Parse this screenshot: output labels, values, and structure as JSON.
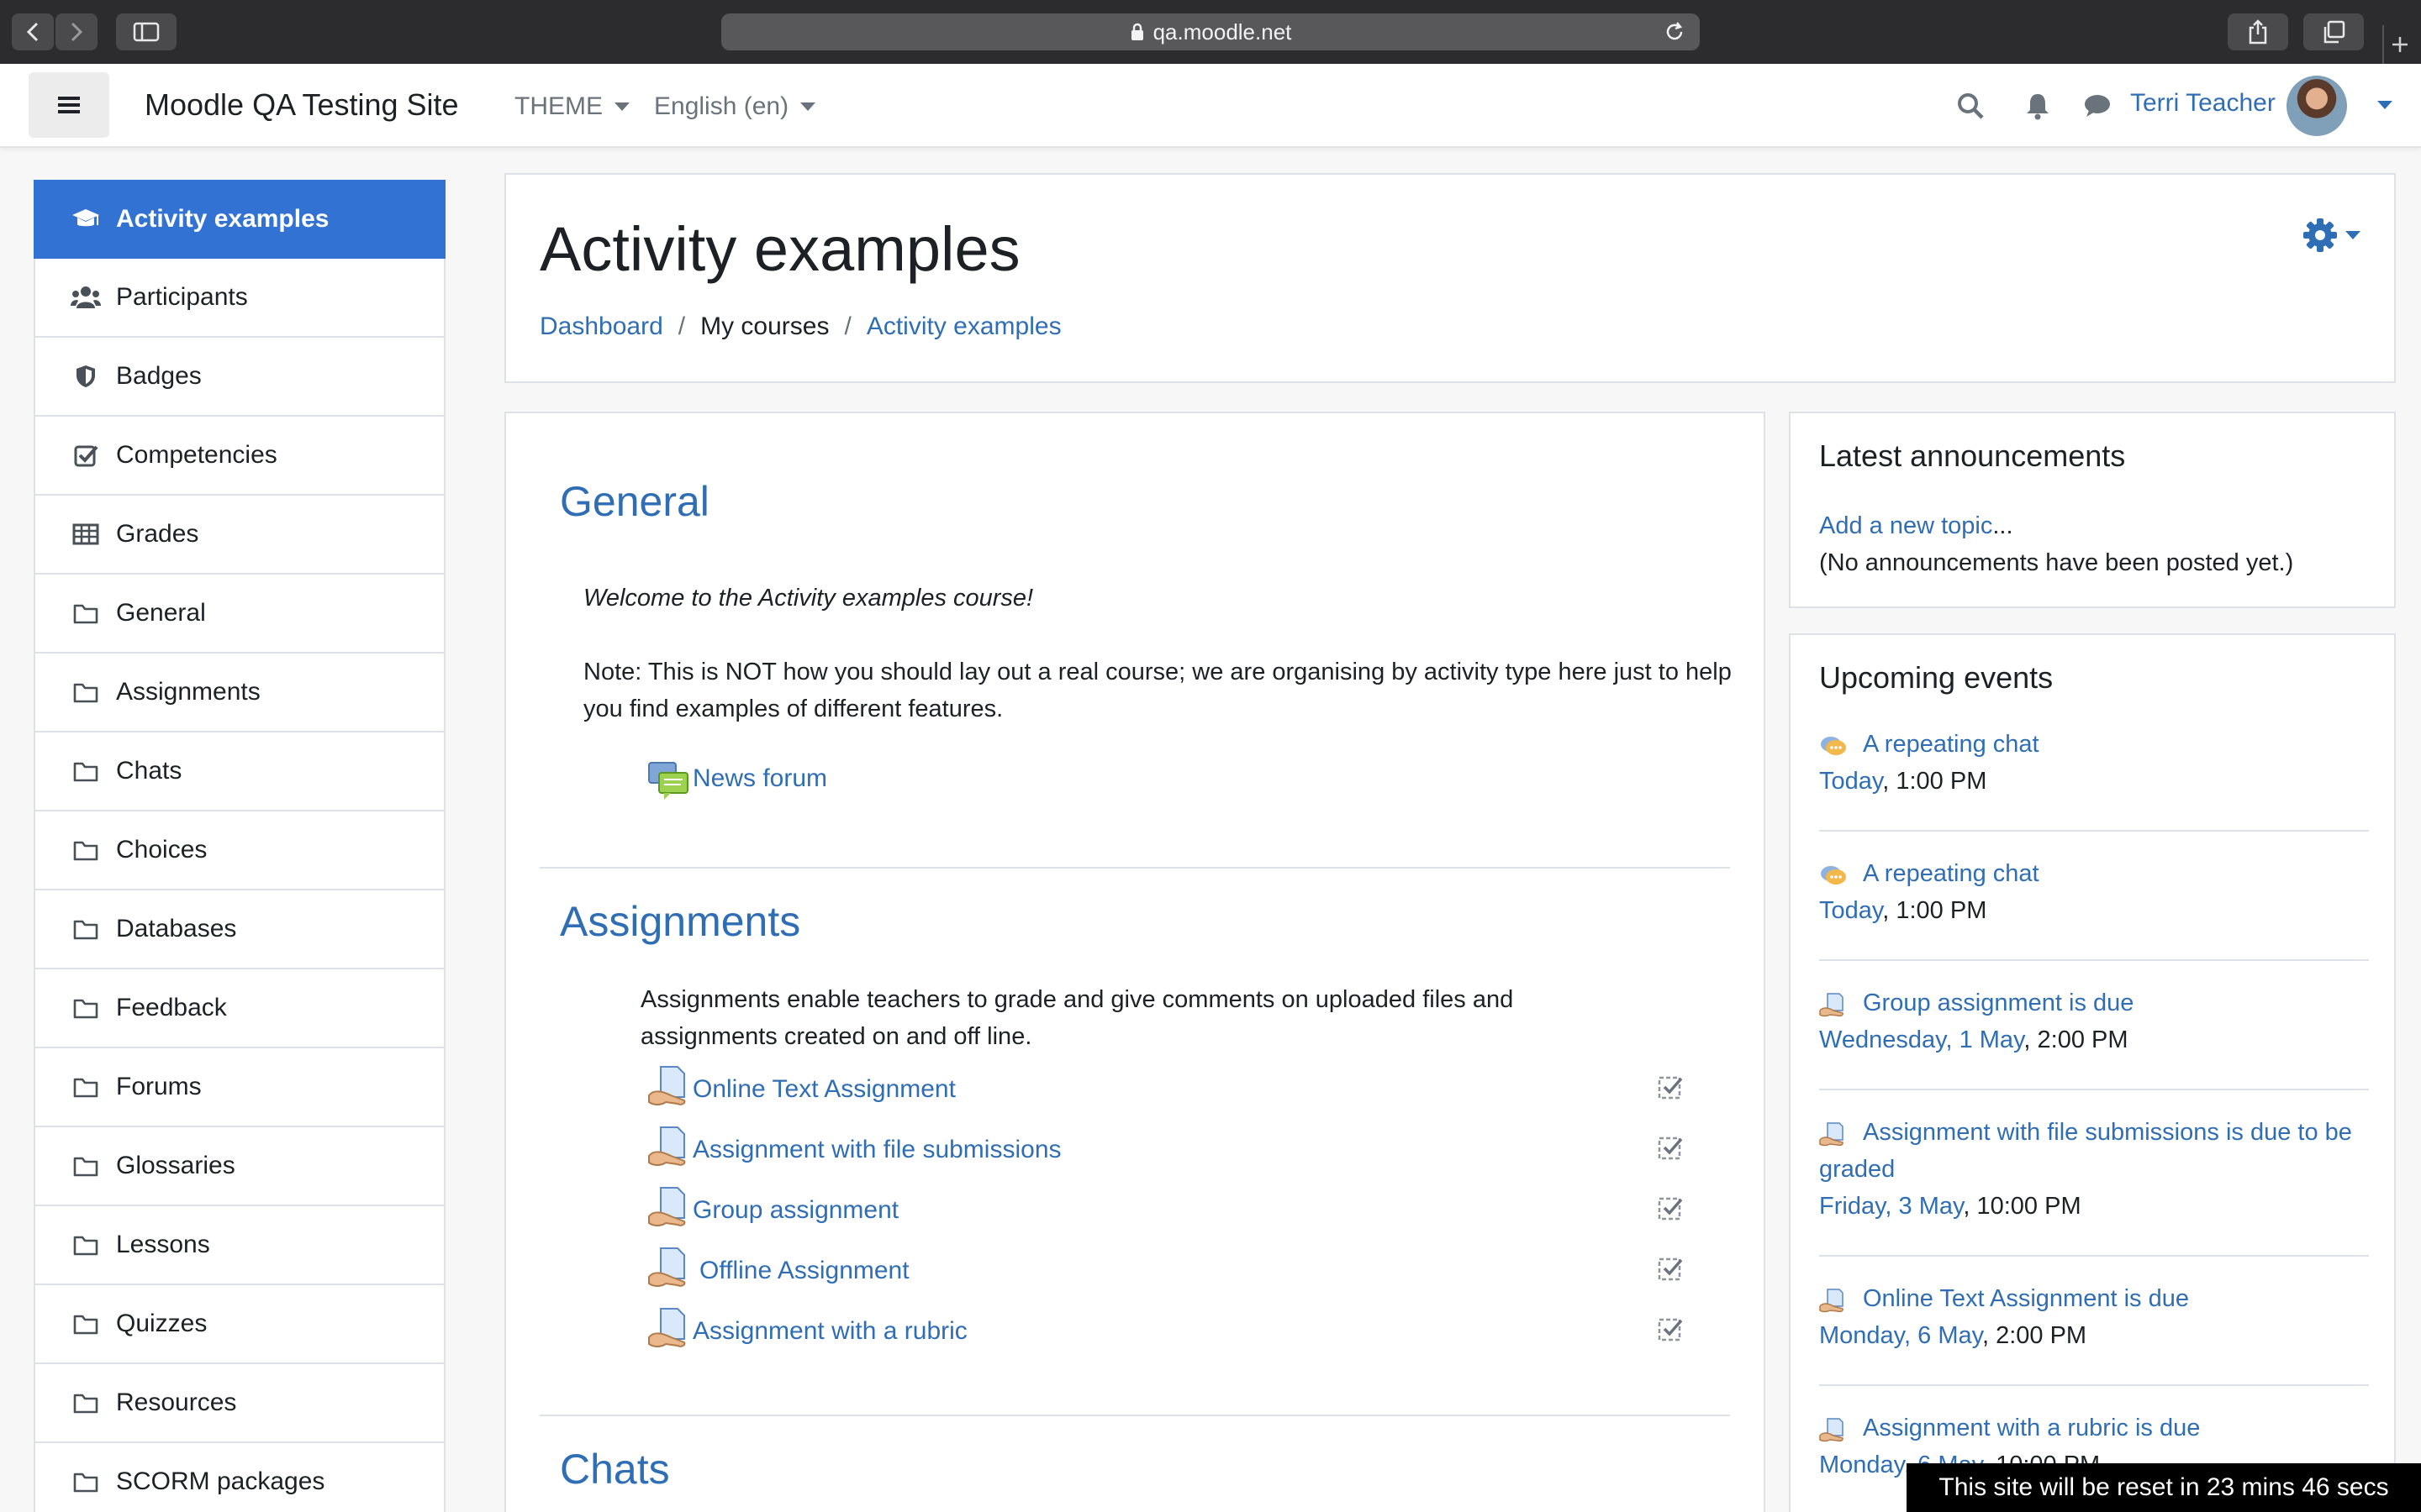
{
  "browser": {
    "url": "qa.moodle.net"
  },
  "navbar": {
    "site_name": "Moodle QA Testing Site",
    "theme_menu": "THEME",
    "language_menu": "English (en)",
    "user_name": "Terri Teacher"
  },
  "drawer": {
    "items": [
      {
        "label": "Activity examples",
        "icon": "graduation-cap-icon"
      },
      {
        "label": "Participants",
        "icon": "users-icon"
      },
      {
        "label": "Badges",
        "icon": "shield-icon"
      },
      {
        "label": "Competencies",
        "icon": "check-square-icon"
      },
      {
        "label": "Grades",
        "icon": "table-icon"
      },
      {
        "label": "General",
        "icon": "folder-icon"
      },
      {
        "label": "Assignments",
        "icon": "folder-icon"
      },
      {
        "label": "Chats",
        "icon": "folder-icon"
      },
      {
        "label": "Choices",
        "icon": "folder-icon"
      },
      {
        "label": "Databases",
        "icon": "folder-icon"
      },
      {
        "label": "Feedback",
        "icon": "folder-icon"
      },
      {
        "label": "Forums",
        "icon": "folder-icon"
      },
      {
        "label": "Glossaries",
        "icon": "folder-icon"
      },
      {
        "label": "Lessons",
        "icon": "folder-icon"
      },
      {
        "label": "Quizzes",
        "icon": "folder-icon"
      },
      {
        "label": "Resources",
        "icon": "folder-icon"
      },
      {
        "label": "SCORM packages",
        "icon": "folder-icon"
      }
    ]
  },
  "header": {
    "title": "Activity examples",
    "breadcrumb": {
      "dashboard": "Dashboard",
      "sep": "/",
      "my_courses": "My courses",
      "course": "Activity examples"
    }
  },
  "course": {
    "general": {
      "title": "General",
      "welcome": "Welcome to the Activity examples course!",
      "note": "Note: This is NOT how you should lay out a real course; we are organising by activity type here just to help you find examples of different features.",
      "news_forum": "News forum"
    },
    "assignments": {
      "title": "Assignments",
      "summary": "Assignments enable teachers to grade and give comments on uploaded files and assignments created on and off line.",
      "items": [
        "Online Text Assignment",
        "Assignment with file submissions",
        "Group assignment",
        "Offline Assignment",
        "Assignment with a rubric"
      ]
    },
    "chats": {
      "title": "Chats"
    }
  },
  "announcements": {
    "title": "Latest announcements",
    "add_topic": "Add a new topic",
    "ellipsis": "...",
    "empty": "(No announcements have been posted yet.)"
  },
  "upcoming": {
    "title": "Upcoming events",
    "events": [
      {
        "name": "A repeating chat",
        "date": "Today",
        "time": ", 1:00 PM",
        "icon": "chat-icon"
      },
      {
        "name": "A repeating chat",
        "date": "Today",
        "time": ", 1:00 PM",
        "icon": "chat-icon"
      },
      {
        "name": "Group assignment is due",
        "date": "Wednesday, 1 May",
        "time": ", 2:00 PM",
        "icon": "assignment-icon"
      },
      {
        "name": "Assignment with file submissions is due to be graded",
        "date": "Friday, 3 May",
        "time": ", 10:00 PM",
        "icon": "assignment-icon"
      },
      {
        "name": "Online Text Assignment is due",
        "date": "Monday, 6 May",
        "time": ", 2:00 PM",
        "icon": "assignment-icon"
      },
      {
        "name": "Assignment with a rubric is due",
        "date": "Monday, 6 May",
        "time": ", 10:00 PM",
        "icon": "assignment-icon"
      }
    ]
  },
  "reset_notice": "This site will be reset in 23 mins 46 secs",
  "colors": {
    "link": "#2f6eb5",
    "active": "#3272d3",
    "border": "#dee2e6"
  }
}
